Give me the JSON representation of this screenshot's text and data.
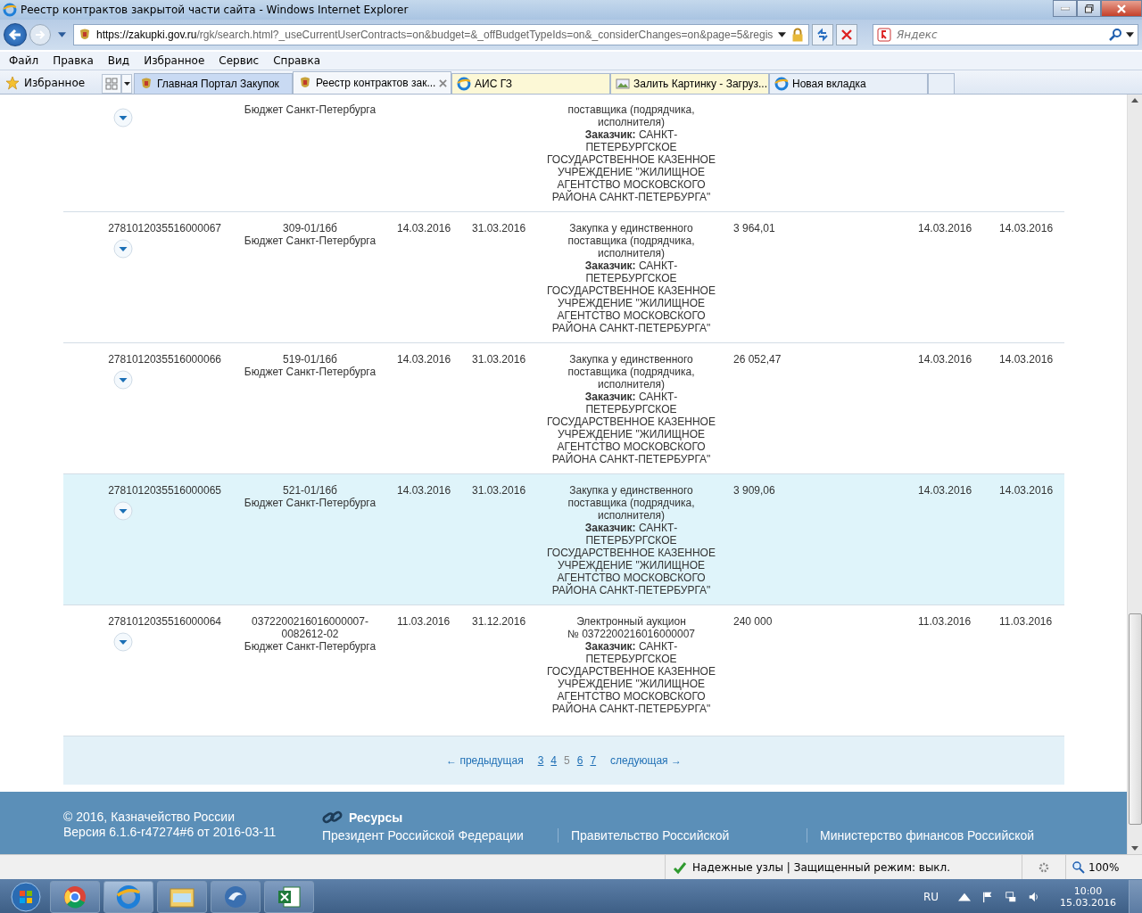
{
  "window": {
    "title": "Реестр контрактов закрытой части сайта - Windows Internet Explorer"
  },
  "address_bar": {
    "url_host": "https://zakupki.gov.ru",
    "url_path": "/rgk/search.html?_useCurrentUserContracts=on&budget=&_offBudgetTypeIds=on&_considerChanges=on&page=5&regis"
  },
  "search": {
    "placeholder": "Яндекс"
  },
  "menu": [
    "Файл",
    "Правка",
    "Вид",
    "Избранное",
    "Сервис",
    "Справка"
  ],
  "favorites": {
    "label": "Избранное"
  },
  "tabs": [
    {
      "label": "Главная Портал Закупок",
      "kind": "crest",
      "selected": false,
      "color": "#c9daf3"
    },
    {
      "label": "Реестр контрактов зак...",
      "kind": "crest",
      "selected": true,
      "color": "#f4f7fb"
    },
    {
      "label": "АИС ГЗ",
      "kind": "ie",
      "selected": false,
      "color": "#fcf8d6"
    },
    {
      "label": "Залить Картинку - Загруз...",
      "kind": "image",
      "selected": false,
      "color": "#fcf8d6"
    },
    {
      "label": "Новая вкладка",
      "kind": "ie",
      "selected": false,
      "color": "#e8eff8"
    }
  ],
  "rows": [
    {
      "kind": "partial",
      "selected": false,
      "contract": [
        "Бюджет Санкт-Петербурга"
      ],
      "description": "поставщика (подрядчика, исполнителя)\n**Заказчик:** САНКТ-ПЕТЕРБУРГСКОЕ ГОСУДАРСТВЕННОЕ КАЗЕННОЕ УЧРЕЖДЕНИЕ \"ЖИЛИЩНОЕ АГЕНТСТВО МОСКОВСКОГО РАЙОНА САНКТ-ПЕТЕРБУРГА\""
    },
    {
      "kind": "full",
      "selected": false,
      "reg_number": "2781012035516000067",
      "contract": [
        "309-01/16б",
        "Бюджет Санкт-Петербурга"
      ],
      "date_1": "14.03.2016",
      "date_2": "31.03.2016",
      "description": "Закупка у единственного поставщика (подрядчика, исполнителя)\n**Заказчик:** САНКТ-ПЕТЕРБУРГСКОЕ ГОСУДАРСТВЕННОЕ КАЗЕННОЕ УЧРЕЖДЕНИЕ \"ЖИЛИЩНОЕ АГЕНТСТВО МОСКОВСКОГО РАЙОНА САНКТ-ПЕТЕРБУРГА\"",
      "price": "3 964,01",
      "date_3": "14.03.2016",
      "date_4": "14.03.2016"
    },
    {
      "kind": "full",
      "selected": false,
      "reg_number": "2781012035516000066",
      "contract": [
        "519-01/16б",
        "Бюджет Санкт-Петербурга"
      ],
      "date_1": "14.03.2016",
      "date_2": "31.03.2016",
      "description": "Закупка у единственного поставщика (подрядчика, исполнителя)\n**Заказчик:** САНКТ-ПЕТЕРБУРГСКОЕ ГОСУДАРСТВЕННОЕ КАЗЕННОЕ УЧРЕЖДЕНИЕ \"ЖИЛИЩНОЕ АГЕНТСТВО МОСКОВСКОГО РАЙОНА САНКТ-ПЕТЕРБУРГА\"",
      "price": "26 052,47",
      "date_3": "14.03.2016",
      "date_4": "14.03.2016"
    },
    {
      "kind": "full",
      "selected": true,
      "reg_number": "2781012035516000065",
      "contract": [
        "521-01/16б",
        "Бюджет Санкт-Петербурга"
      ],
      "date_1": "14.03.2016",
      "date_2": "31.03.2016",
      "description": "Закупка у единственного поставщика (подрядчика, исполнителя)\n**Заказчик:** САНКТ-ПЕТЕРБУРГСКОЕ ГОСУДАРСТВЕННОЕ КАЗЕННОЕ УЧРЕЖДЕНИЕ \"ЖИЛИЩНОЕ АГЕНТСТВО МОСКОВСКОГО РАЙОНА САНКТ-ПЕТЕРБУРГА\"",
      "price": "3 909,06",
      "date_3": "14.03.2016",
      "date_4": "14.03.2016"
    },
    {
      "kind": "full",
      "selected": false,
      "reg_number": "2781012035516000064",
      "contract": [
        "0372200216016000007-",
        "0082612-02",
        "Бюджет Санкт-Петербурга"
      ],
      "date_1": "11.03.2016",
      "date_2": "31.12.2016",
      "description": "Электронный аукцион\n№ 0372200216016000007\n**Заказчик:** САНКТ-ПЕТЕРБУРГСКОЕ ГОСУДАРСТВЕННОЕ КАЗЕННОЕ УЧРЕЖДЕНИЕ \"ЖИЛИЩНОЕ АГЕНТСТВО МОСКОВСКОГО РАЙОНА САНКТ-ПЕТЕРБУРГА\"",
      "price": "240 000",
      "date_3": "11.03.2016",
      "date_4": "11.03.2016"
    }
  ],
  "pagination": {
    "prev": "← предыдущая",
    "pages": [
      {
        "label": "3",
        "selected": false
      },
      {
        "label": "4",
        "selected": false
      },
      {
        "label": "5",
        "selected": true
      },
      {
        "label": "6",
        "selected": false
      },
      {
        "label": "7",
        "selected": false
      }
    ],
    "next": "следующая →"
  },
  "footer": {
    "copyright": "© 2016, Казначейство России",
    "version": "Версия 6.1.6-r47274#6 от 2016-03-11",
    "resources_title": "Ресурсы",
    "links": [
      "Президент Российской Федерации",
      "Правительство Российской",
      "Министерство финансов Российской"
    ]
  },
  "status_bar": {
    "zone": "Надежные узлы | Защищенный режим: выкл.",
    "zoom": "100%"
  },
  "taskbar": {
    "language": "RU",
    "time": "10:00",
    "date": "15.03.2016"
  }
}
